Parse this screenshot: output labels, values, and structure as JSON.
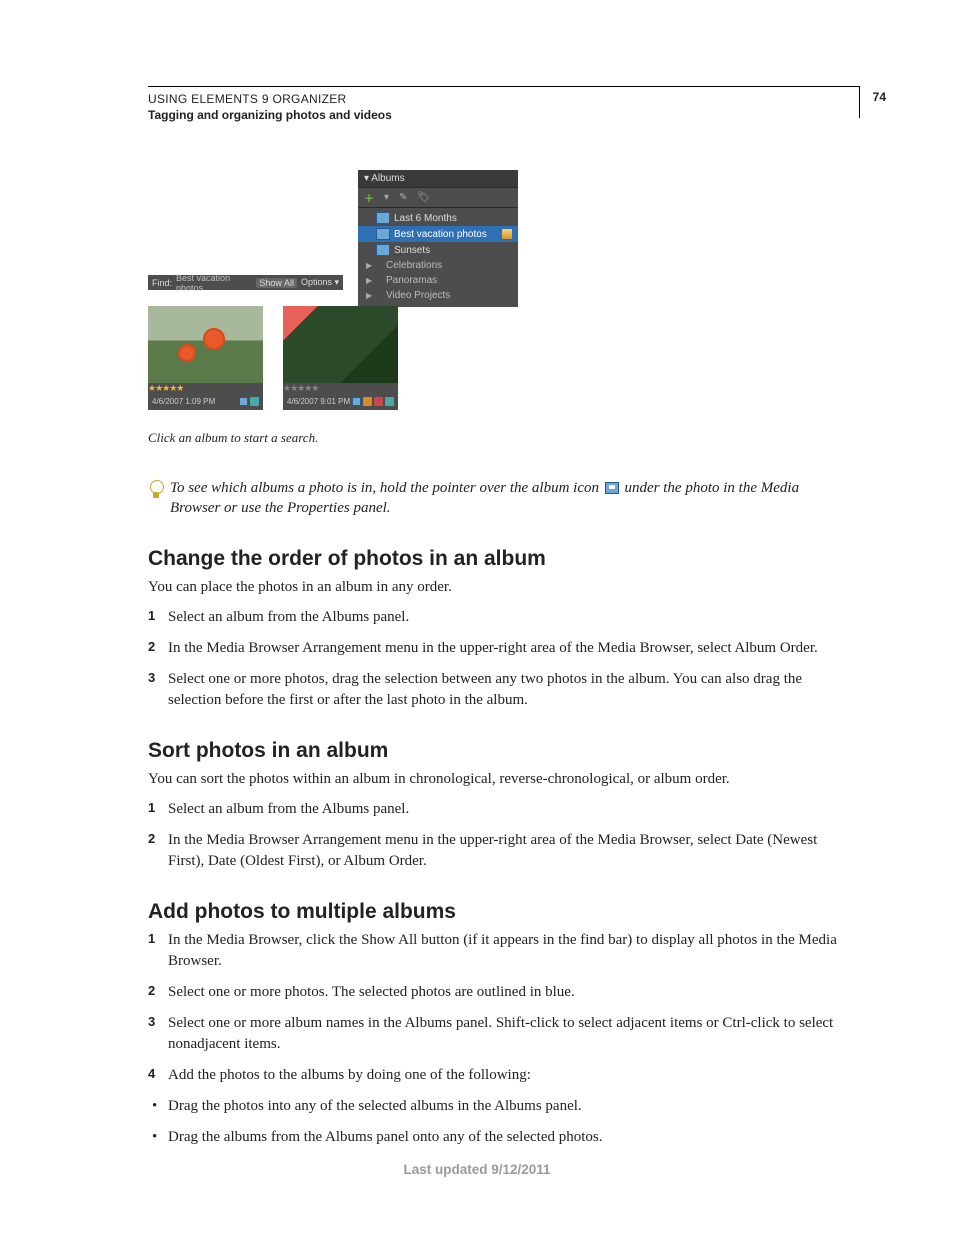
{
  "page": {
    "number": "74",
    "header_title": "USING ELEMENTS 9 ORGANIZER",
    "header_sub": "Tagging and organizing photos and videos",
    "footer": "Last updated 9/12/2011"
  },
  "figure": {
    "albums_panel": {
      "title": "Albums",
      "items": [
        {
          "label": "Last 6 Months"
        },
        {
          "label": "Best vacation photos",
          "selected": true,
          "shared": true
        },
        {
          "label": "Sunsets"
        },
        {
          "label": "Celebrations",
          "sub": true
        },
        {
          "label": "Panoramas",
          "sub": true
        },
        {
          "label": "Video Projects",
          "sub": true
        }
      ]
    },
    "find_bar": {
      "label": "Find:",
      "value": "Best vacation photos",
      "show_all": "Show All",
      "options": "Options ▾"
    },
    "thumbs": [
      {
        "date": "4/6/2007 1:09 PM",
        "stars_gold": true
      },
      {
        "date": "4/6/2007 9:01 PM",
        "stars_gold": false
      }
    ],
    "caption": "Click an album to start a search."
  },
  "tip": {
    "before": "To see which albums a photo is in, hold the pointer over the album icon ",
    "after": " under the photo in the Media Browser or use the Properties panel."
  },
  "sec1": {
    "title": "Change the order of photos in an album",
    "intro": "You can place the photos in an album in any order.",
    "steps": [
      "Select an album from the Albums panel.",
      "In the Media Browser Arrangement menu in the upper-right area of the Media Browser, select Album Order.",
      "Select one or more photos, drag the selection between any two photos in the album. You can also drag the selection before the first or after the last photo in the album."
    ]
  },
  "sec2": {
    "title": "Sort photos in an album",
    "intro": "You can sort the photos within an album in chronological, reverse-chronological, or album order.",
    "steps": [
      "Select an album from the Albums panel.",
      "In the Media Browser Arrangement menu in the upper-right area of the Media Browser, select Date (Newest First), Date (Oldest First), or Album Order."
    ]
  },
  "sec3": {
    "title": "Add photos to multiple albums",
    "steps": [
      "In the Media Browser, click the Show All button (if it appears in the find bar) to display all photos in the Media Browser.",
      "Select one or more photos. The selected photos are outlined in blue.",
      "Select one or more album names in the Albums panel. Shift-click to select adjacent items or Ctrl-click to select nonadjacent items.",
      "Add the photos to the albums by doing one of the following:"
    ],
    "bullets": [
      "Drag the photos into any of the selected albums in the Albums panel.",
      "Drag the albums from the Albums panel onto any of the selected photos."
    ]
  }
}
